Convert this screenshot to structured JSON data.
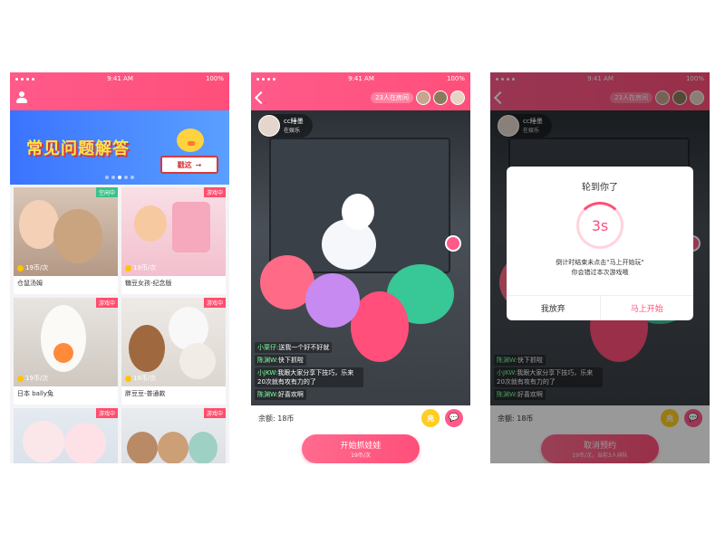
{
  "status": {
    "time": "9:41 AM",
    "battery": "100%"
  },
  "screen1": {
    "banner": {
      "title": "常见问题解答",
      "button": "戳这",
      "arrow": "→"
    },
    "cards": [
      {
        "name": "仓鼠汤姆",
        "price": "19币/次",
        "tag": "空闲中",
        "tag_color": "#3ac289"
      },
      {
        "name": "糖豆女孩-纪念版",
        "price": "19币/次",
        "tag": "游戏中",
        "tag_color": "#ff4d6d"
      },
      {
        "name": "日本 bally兔",
        "price": "19币/次",
        "tag": "游戏中",
        "tag_color": "#ff4d6d"
      },
      {
        "name": "胖豆豆-普通款",
        "price": "19币/次",
        "tag": "游戏中",
        "tag_color": "#ff4d6d"
      },
      {
        "name": "",
        "price": "",
        "tag": "游戏中",
        "tag_color": "#ff4d6d"
      },
      {
        "name": "",
        "price": "",
        "tag": "游戏中",
        "tag_color": "#ff4d6d"
      }
    ]
  },
  "screen2": {
    "room_count": "23人在房间",
    "host": {
      "name": "cc睡墨",
      "status": "在娱乐"
    },
    "chat": [
      {
        "user": "小栗仔:",
        "text": "送我一个好不好就"
      },
      {
        "user": "陈渊W:",
        "text": "快下抓啦"
      },
      {
        "user": "小JKW:",
        "text": "我跟大家分享下技巧，乐来20次就有攻有力的了"
      },
      {
        "user": "陈渊W:",
        "text": "好喜欢啊"
      }
    ],
    "balance": "余额: 18币",
    "recharge": "充",
    "chat_icon": "💬",
    "main_button": {
      "label": "开始抓娃娃",
      "sub": "19币/次"
    }
  },
  "screen3": {
    "room_count": "23人在房间",
    "host": {
      "name": "cc睡墨",
      "status": "在娱乐"
    },
    "dialog": {
      "title": "轮到你了",
      "countdown": "3s",
      "message_line1": "倒计时结束未点击\"马上开始玩\"",
      "message_line2": "你会错过本次游戏哦",
      "cancel": "我放弃",
      "confirm": "马上开始"
    },
    "chat": [
      {
        "user": "陈渊W:",
        "text": "快下抓啦"
      },
      {
        "user": "小JKW:",
        "text": "我跟大家分享下技巧，乐来20次就有攻有力的了"
      },
      {
        "user": "陈渊W:",
        "text": "好喜欢啊"
      }
    ],
    "balance": "余额: 18币",
    "recharge": "充",
    "chat_icon": "💬",
    "main_button": {
      "label": "取消预约",
      "sub": "19币/次，当前3人排队"
    }
  }
}
